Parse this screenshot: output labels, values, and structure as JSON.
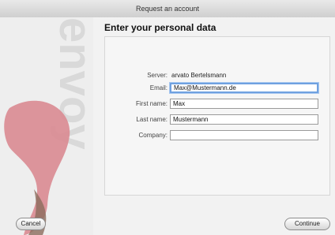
{
  "window": {
    "title": "Request an account"
  },
  "brand": {
    "logo_text": "envoy"
  },
  "form": {
    "heading": "Enter your personal data",
    "server": {
      "label": "Server:",
      "value": "arvato Bertelsmann"
    },
    "email": {
      "label": "Email:",
      "value": "Max@Mustermann.de"
    },
    "first_name": {
      "label": "First name:",
      "value": "Max"
    },
    "last_name": {
      "label": "Last name:",
      "value": "Mustermann"
    },
    "company": {
      "label": "Company:",
      "value": ""
    }
  },
  "buttons": {
    "cancel": "Cancel",
    "continue": "Continue"
  },
  "colors": {
    "accent_focus": "#6fa1e0",
    "brand_pink": "#d98a91",
    "brand_brown": "#8b6c5c"
  }
}
